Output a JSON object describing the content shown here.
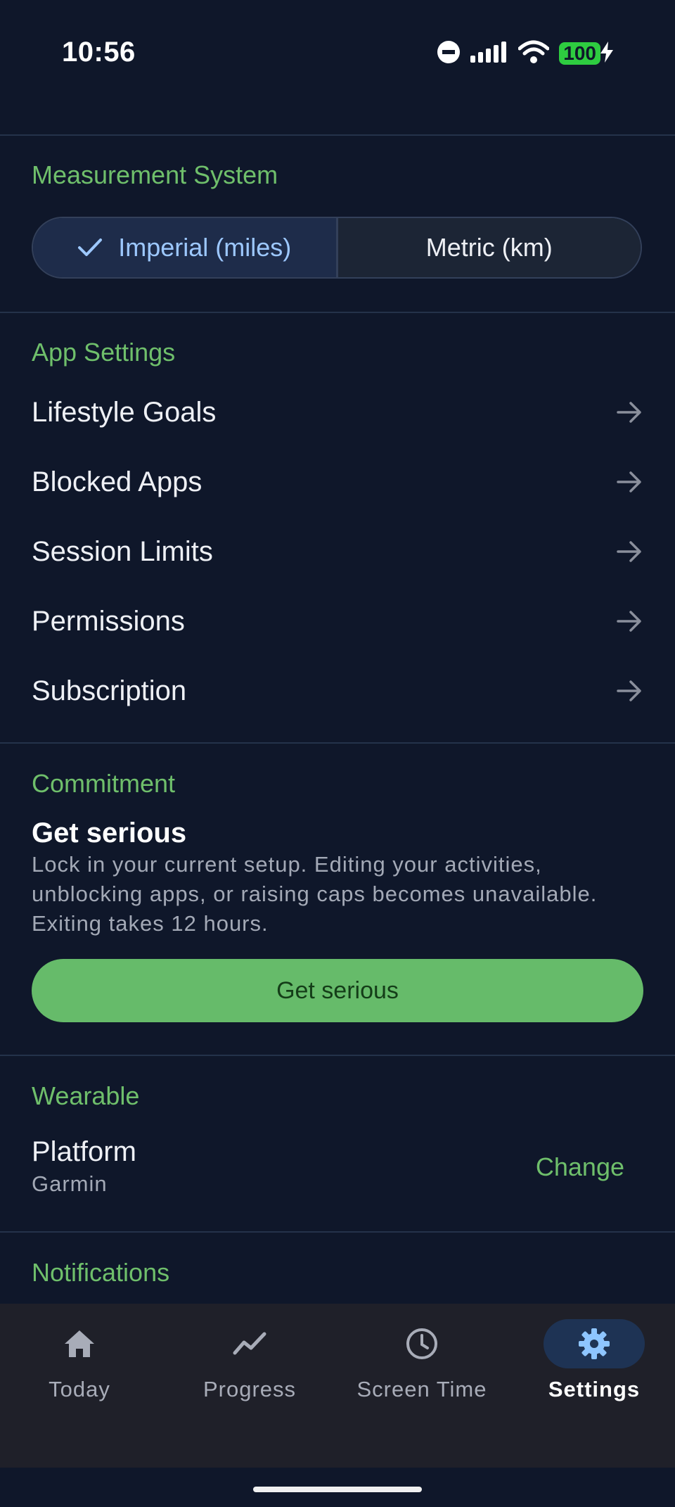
{
  "status_bar": {
    "time": "10:56",
    "battery": "100"
  },
  "measurement": {
    "title": "Measurement System",
    "options": [
      {
        "label": "Imperial (miles)",
        "selected": true
      },
      {
        "label": "Metric (km)",
        "selected": false
      }
    ]
  },
  "app_settings": {
    "title": "App Settings",
    "items": [
      {
        "label": "Lifestyle Goals"
      },
      {
        "label": "Blocked Apps"
      },
      {
        "label": "Session Limits"
      },
      {
        "label": "Permissions"
      },
      {
        "label": "Subscription"
      }
    ]
  },
  "commitment": {
    "title": "Commitment",
    "heading": "Get serious",
    "description": "Lock in your current setup. Editing your activities, unblocking apps, or raising caps becomes unavailable. Exiting takes 12 hours.",
    "button": "Get serious"
  },
  "wearable": {
    "title": "Wearable",
    "platform_label": "Platform",
    "platform_value": "Garmin",
    "change_label": "Change"
  },
  "notifications": {
    "title": "Notifications"
  },
  "nav": {
    "items": [
      {
        "label": "Today",
        "icon": "home-icon"
      },
      {
        "label": "Progress",
        "icon": "trend-icon"
      },
      {
        "label": "Screen Time",
        "icon": "clock-icon"
      },
      {
        "label": "Settings",
        "icon": "gear-icon",
        "active": true
      }
    ]
  },
  "colors": {
    "background": "#0f172a",
    "accent_green": "#66bb6a",
    "selected_blue": "#9dc8ff"
  }
}
